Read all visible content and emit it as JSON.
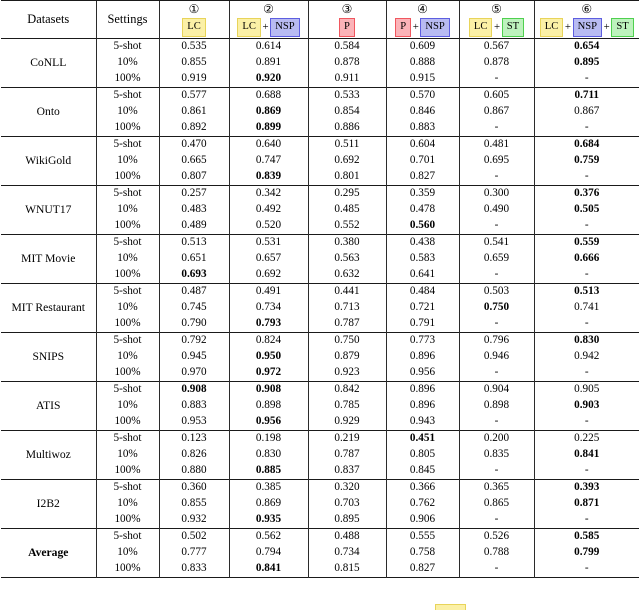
{
  "table": {
    "header": {
      "col_datasets": "Datasets",
      "col_settings": "Settings",
      "methods": [
        {
          "number": "①",
          "badges": [
            {
              "text": "LC",
              "style": "lc"
            }
          ]
        },
        {
          "number": "②",
          "badges": [
            {
              "text": "LC",
              "style": "lc"
            },
            {
              "text": "+",
              "style": "plus"
            },
            {
              "text": "NSP",
              "style": "nsp"
            }
          ]
        },
        {
          "number": "③",
          "badges": [
            {
              "text": "P",
              "style": "p"
            }
          ]
        },
        {
          "number": "④",
          "badges": [
            {
              "text": "P",
              "style": "p"
            },
            {
              "text": "+",
              "style": "plus"
            },
            {
              "text": "NSP",
              "style": "nsp"
            }
          ]
        },
        {
          "number": "⑤",
          "badges": [
            {
              "text": "LC",
              "style": "lc"
            },
            {
              "text": "+",
              "style": "plus"
            },
            {
              "text": "ST",
              "style": "st"
            }
          ]
        },
        {
          "number": "⑥",
          "badges": [
            {
              "text": "LC",
              "style": "lc"
            },
            {
              "text": "+",
              "style": "plus"
            },
            {
              "text": "NSP",
              "style": "nsp"
            },
            {
              "text": "+",
              "style": "plus"
            },
            {
              "text": "ST",
              "style": "st"
            }
          ]
        }
      ]
    },
    "settings_labels": [
      "5-shot",
      "10%",
      "100%"
    ],
    "rows": [
      {
        "dataset": "CoNLL",
        "bold_dataset": false,
        "values": [
          [
            "0.535",
            "0.614",
            "0.584",
            "0.609",
            "0.567",
            "0.654"
          ],
          [
            "0.855",
            "0.891",
            "0.878",
            "0.888",
            "0.878",
            "0.895"
          ],
          [
            "0.919",
            "0.920",
            "0.911",
            "0.915",
            "-",
            "-"
          ]
        ],
        "bold": [
          [
            false,
            false,
            false,
            false,
            false,
            true
          ],
          [
            false,
            false,
            false,
            false,
            false,
            true
          ],
          [
            false,
            true,
            false,
            false,
            false,
            false
          ]
        ]
      },
      {
        "dataset": "Onto",
        "bold_dataset": false,
        "values": [
          [
            "0.577",
            "0.688",
            "0.533",
            "0.570",
            "0.605",
            "0.711"
          ],
          [
            "0.861",
            "0.869",
            "0.854",
            "0.846",
            "0.867",
            "0.867"
          ],
          [
            "0.892",
            "0.899",
            "0.886",
            "0.883",
            "-",
            "-"
          ]
        ],
        "bold": [
          [
            false,
            false,
            false,
            false,
            false,
            true
          ],
          [
            false,
            true,
            false,
            false,
            false,
            false
          ],
          [
            false,
            true,
            false,
            false,
            false,
            false
          ]
        ]
      },
      {
        "dataset": "WikiGold",
        "bold_dataset": false,
        "values": [
          [
            "0.470",
            "0.640",
            "0.511",
            "0.604",
            "0.481",
            "0.684"
          ],
          [
            "0.665",
            "0.747",
            "0.692",
            "0.701",
            "0.695",
            "0.759"
          ],
          [
            "0.807",
            "0.839",
            "0.801",
            "0.827",
            "-",
            "-"
          ]
        ],
        "bold": [
          [
            false,
            false,
            false,
            false,
            false,
            true
          ],
          [
            false,
            false,
            false,
            false,
            false,
            true
          ],
          [
            false,
            true,
            false,
            false,
            false,
            false
          ]
        ]
      },
      {
        "dataset": "WNUT17",
        "bold_dataset": false,
        "values": [
          [
            "0.257",
            "0.342",
            "0.295",
            "0.359",
            "0.300",
            "0.376"
          ],
          [
            "0.483",
            "0.492",
            "0.485",
            "0.478",
            "0.490",
            "0.505"
          ],
          [
            "0.489",
            "0.520",
            "0.552",
            "0.560",
            "-",
            "-"
          ]
        ],
        "bold": [
          [
            false,
            false,
            false,
            false,
            false,
            true
          ],
          [
            false,
            false,
            false,
            false,
            false,
            true
          ],
          [
            false,
            false,
            false,
            true,
            false,
            false
          ]
        ]
      },
      {
        "dataset": "MIT Movie",
        "bold_dataset": false,
        "values": [
          [
            "0.513",
            "0.531",
            "0.380",
            "0.438",
            "0.541",
            "0.559"
          ],
          [
            "0.651",
            "0.657",
            "0.563",
            "0.583",
            "0.659",
            "0.666"
          ],
          [
            "0.693",
            "0.692",
            "0.632",
            "0.641",
            "-",
            "-"
          ]
        ],
        "bold": [
          [
            false,
            false,
            false,
            false,
            false,
            true
          ],
          [
            false,
            false,
            false,
            false,
            false,
            true
          ],
          [
            true,
            false,
            false,
            false,
            false,
            false
          ]
        ]
      },
      {
        "dataset": "MIT Restaurant",
        "bold_dataset": false,
        "values": [
          [
            "0.487",
            "0.491",
            "0.441",
            "0.484",
            "0.503",
            "0.513"
          ],
          [
            "0.745",
            "0.734",
            "0.713",
            "0.721",
            "0.750",
            "0.741"
          ],
          [
            "0.790",
            "0.793",
            "0.787",
            "0.791",
            "-",
            "-"
          ]
        ],
        "bold": [
          [
            false,
            false,
            false,
            false,
            false,
            true
          ],
          [
            false,
            false,
            false,
            false,
            true,
            false
          ],
          [
            false,
            true,
            false,
            false,
            false,
            false
          ]
        ]
      },
      {
        "dataset": "SNIPS",
        "bold_dataset": false,
        "values": [
          [
            "0.792",
            "0.824",
            "0.750",
            "0.773",
            "0.796",
            "0.830"
          ],
          [
            "0.945",
            "0.950",
            "0.879",
            "0.896",
            "0.946",
            "0.942"
          ],
          [
            "0.970",
            "0.972",
            "0.923",
            "0.956",
            "-",
            "-"
          ]
        ],
        "bold": [
          [
            false,
            false,
            false,
            false,
            false,
            true
          ],
          [
            false,
            true,
            false,
            false,
            false,
            false
          ],
          [
            false,
            true,
            false,
            false,
            false,
            false
          ]
        ]
      },
      {
        "dataset": "ATIS",
        "bold_dataset": false,
        "values": [
          [
            "0.908",
            "0.908",
            "0.842",
            "0.896",
            "0.904",
            "0.905"
          ],
          [
            "0.883",
            "0.898",
            "0.785",
            "0.896",
            "0.898",
            "0.903"
          ],
          [
            "0.953",
            "0.956",
            "0.929",
            "0.943",
            "-",
            "-"
          ]
        ],
        "bold": [
          [
            true,
            true,
            false,
            false,
            false,
            false
          ],
          [
            false,
            false,
            false,
            false,
            false,
            true
          ],
          [
            false,
            true,
            false,
            false,
            false,
            false
          ]
        ]
      },
      {
        "dataset": "Multiwoz",
        "bold_dataset": false,
        "values": [
          [
            "0.123",
            "0.198",
            "0.219",
            "0.451",
            "0.200",
            "0.225"
          ],
          [
            "0.826",
            "0.830",
            "0.787",
            "0.805",
            "0.835",
            "0.841"
          ],
          [
            "0.880",
            "0.885",
            "0.837",
            "0.845",
            "-",
            "-"
          ]
        ],
        "bold": [
          [
            false,
            false,
            false,
            true,
            false,
            false
          ],
          [
            false,
            false,
            false,
            false,
            false,
            true
          ],
          [
            false,
            true,
            false,
            false,
            false,
            false
          ]
        ]
      },
      {
        "dataset": "I2B2",
        "bold_dataset": false,
        "values": [
          [
            "0.360",
            "0.385",
            "0.320",
            "0.366",
            "0.365",
            "0.393"
          ],
          [
            "0.855",
            "0.869",
            "0.703",
            "0.762",
            "0.865",
            "0.871"
          ],
          [
            "0.932",
            "0.935",
            "0.895",
            "0.906",
            "-",
            "-"
          ]
        ],
        "bold": [
          [
            false,
            false,
            false,
            false,
            false,
            true
          ],
          [
            false,
            false,
            false,
            false,
            false,
            true
          ],
          [
            false,
            true,
            false,
            false,
            false,
            false
          ]
        ]
      },
      {
        "dataset": "Average",
        "bold_dataset": true,
        "values": [
          [
            "0.502",
            "0.562",
            "0.488",
            "0.555",
            "0.526",
            "0.585"
          ],
          [
            "0.777",
            "0.794",
            "0.734",
            "0.758",
            "0.788",
            "0.799"
          ],
          [
            "0.833",
            "0.841",
            "0.815",
            "0.827",
            "-",
            "-"
          ]
        ],
        "bold": [
          [
            false,
            false,
            false,
            false,
            false,
            true
          ],
          [
            false,
            false,
            false,
            false,
            false,
            true
          ],
          [
            false,
            true,
            false,
            false,
            false,
            false
          ]
        ]
      }
    ]
  }
}
